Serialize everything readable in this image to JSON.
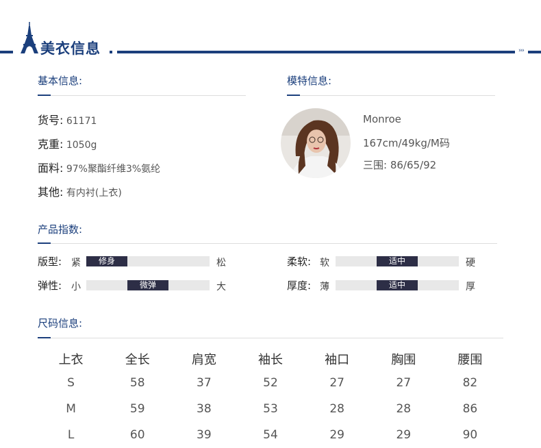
{
  "header": {
    "title": "美衣信息"
  },
  "basic_info": {
    "title": "基本信息:",
    "rows": [
      {
        "label": "货号:",
        "value": "61171"
      },
      {
        "label": "克重:",
        "value": "1050g"
      },
      {
        "label": "面料:",
        "value": "97%聚酯纤维3%氨纶"
      },
      {
        "label": "其他:",
        "value": "有内衬(上衣)"
      }
    ]
  },
  "model_info": {
    "title": "模特信息:",
    "name": "Monroe",
    "stats": "167cm/49kg/M码",
    "measurements": "三围: 86/65/92"
  },
  "product_index": {
    "title": "产品指数:",
    "rows": [
      {
        "label": "版型:",
        "left": "紧",
        "right": "松",
        "value": "修身",
        "level": 0
      },
      {
        "label": "柔软:",
        "left": "软",
        "right": "硬",
        "value": "适中",
        "level": 0.5
      },
      {
        "label": "弹性:",
        "left": "小",
        "right": "大",
        "value": "微弹",
        "level": 0.5
      },
      {
        "label": "厚度:",
        "left": "薄",
        "right": "厚",
        "value": "适中",
        "level": 0.5
      }
    ]
  },
  "size_info": {
    "title": "尺码信息:",
    "headers": [
      "上衣",
      "全长",
      "肩宽",
      "袖长",
      "袖口",
      "胸围",
      "腰围"
    ],
    "rows": [
      [
        "S",
        "58",
        "37",
        "52",
        "27",
        "27",
        "82"
      ],
      [
        "M",
        "59",
        "38",
        "53",
        "28",
        "28",
        "86"
      ],
      [
        "L",
        "60",
        "39",
        "54",
        "29",
        "29",
        "90"
      ]
    ]
  }
}
